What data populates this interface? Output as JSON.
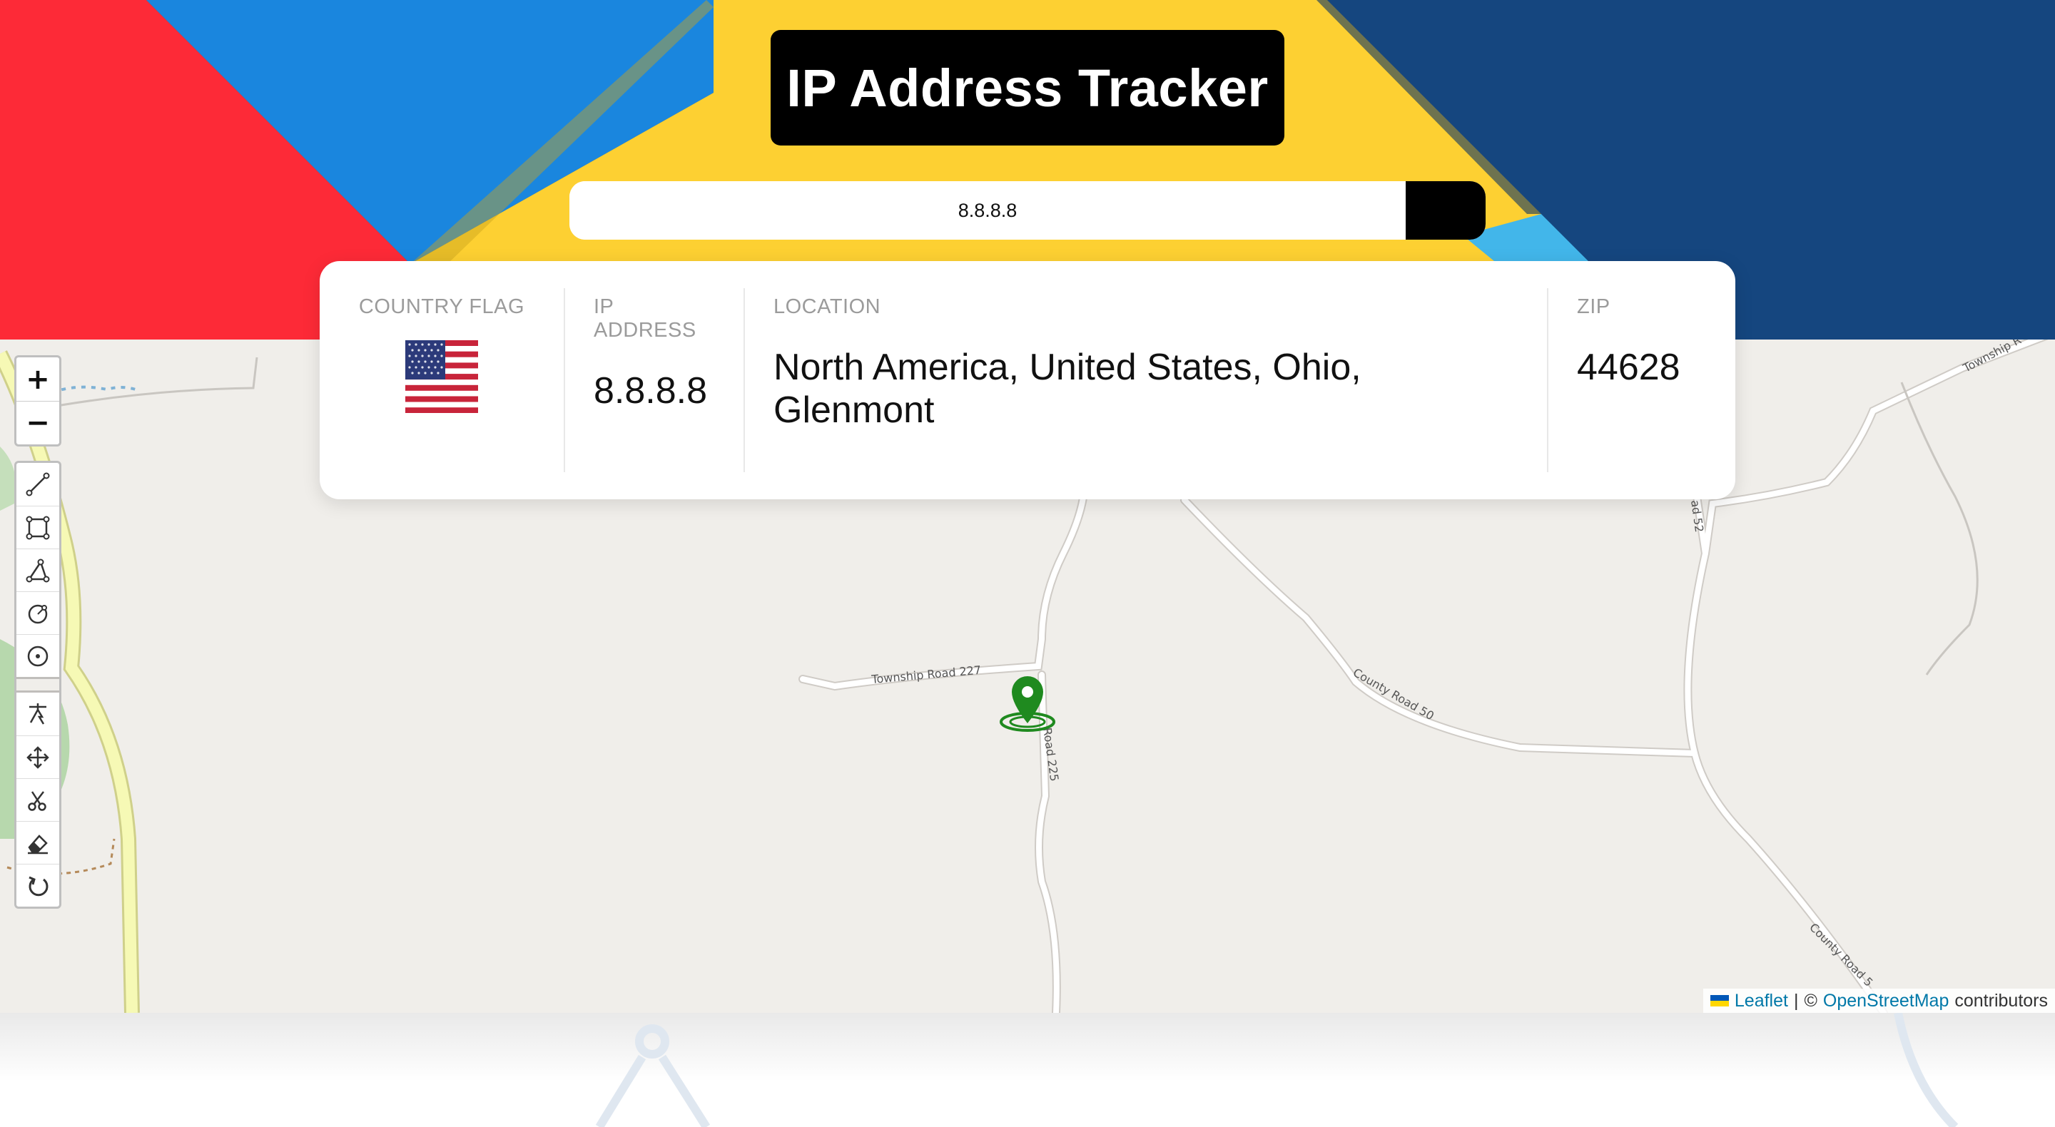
{
  "app": {
    "title": "IP Address Tracker"
  },
  "search": {
    "value": "8.8.8.8",
    "submit_icon": "chevron-right-icon"
  },
  "info": {
    "flag_label": "COUNTRY FLAG",
    "flag_icon": "us-flag-icon",
    "ip_label": "IP ADDRESS",
    "ip_value": "8.8.8.8",
    "location_label": "LOCATION",
    "location_value": "North America, United States, Ohio, Glenmont",
    "zip_label": "ZIP",
    "zip_value": "44628"
  },
  "map": {
    "zoom_in": "+",
    "zoom_out": "−",
    "road_labels": [
      "Township Road 227",
      "County Road 50",
      "Road 225",
      "County Road 5",
      "Township R",
      "ad 52"
    ],
    "draw_tools": [
      "polyline-icon",
      "rectangle-icon",
      "polygon-icon",
      "circle-icon",
      "circle-marker-icon"
    ],
    "edit_tools": [
      "cursor-drag-icon",
      "move-icon",
      "scissors-icon",
      "eraser-icon",
      "rotate-icon"
    ],
    "marker_icon": "location-pin-icon",
    "attribution": {
      "leaflet": "Leaflet",
      "separator": "|",
      "copyright": "©",
      "osm": "OpenStreetMap",
      "suffix": "contributors"
    }
  },
  "colors": {
    "red": "#fd2a37",
    "blue": "#1a86de",
    "yellow": "#fdd032",
    "navy": "#15467f",
    "marker_green": "#1f8a1f"
  }
}
